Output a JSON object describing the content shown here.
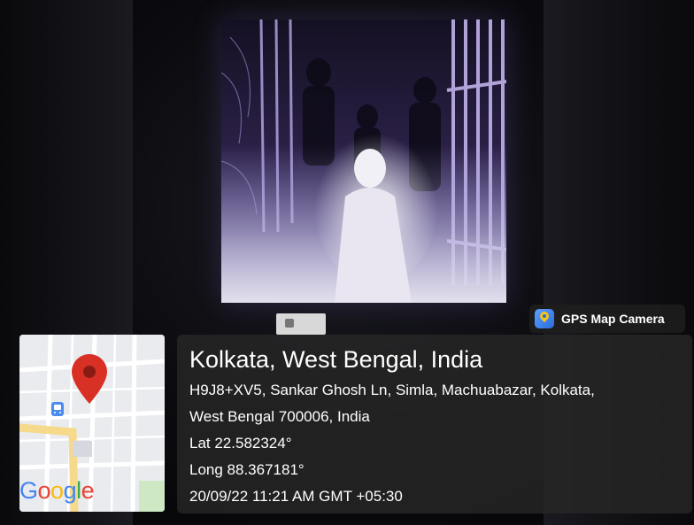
{
  "app_badge": {
    "label": "GPS Map Camera",
    "icon": "map-pin-icon"
  },
  "location": {
    "title": "Kolkata, West Bengal, India",
    "address_line1": "H9J8+XV5, Sankar Ghosh Ln, Simla, Machuabazar, Kolkata,",
    "address_line2": "West Bengal 700006, India",
    "lat": "Lat 22.582324°",
    "long": "Long 88.367181°",
    "datetime": "20/09/22 11:21 AM GMT +05:30"
  },
  "map": {
    "logo_text": "Google",
    "marker_icon": "location-marker-icon",
    "transit_icon": "bus-icon",
    "marker_color": "#d93025"
  }
}
